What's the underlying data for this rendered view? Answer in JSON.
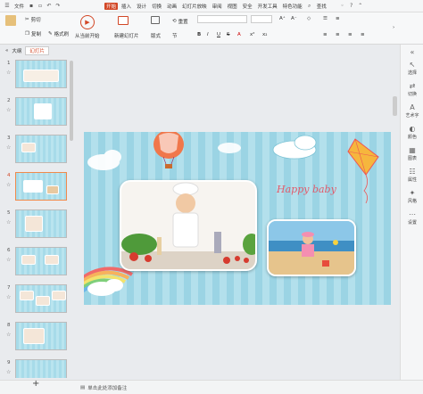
{
  "menubar": {
    "file_label": "文件",
    "tabs": [
      "开始",
      "插入",
      "设计",
      "切换",
      "动画",
      "幻灯片放映",
      "审阅",
      "视图",
      "安全",
      "开发工具",
      "特色功能"
    ],
    "active_tab": "开始",
    "search_label": "查找"
  },
  "ribbon": {
    "cut": "剪切",
    "copy": "复制",
    "format_painter": "格式刷",
    "from_current": "从当前开始",
    "new_slide": "新建幻灯片",
    "layout": "版式",
    "section": "节",
    "reset": "重置"
  },
  "panel": {
    "outline_tab": "大纲",
    "slides_tab": "幻灯片",
    "add_button": "+"
  },
  "slides": [
    {
      "num": "1"
    },
    {
      "num": "2"
    },
    {
      "num": "3"
    },
    {
      "num": "4"
    },
    {
      "num": "5"
    },
    {
      "num": "6"
    },
    {
      "num": "7"
    },
    {
      "num": "8"
    },
    {
      "num": "9"
    }
  ],
  "selected_slide": 4,
  "slide": {
    "title": "Happy baby"
  },
  "rightbar": {
    "items": [
      "选择",
      "切换",
      "艺术字",
      "颜色",
      "图表",
      "属性",
      "风格",
      "设置"
    ]
  },
  "status": {
    "notes_placeholder": "单击此处添加备注"
  },
  "colors": {
    "accent": "#d24726",
    "slide_stripe_a": "#9bd4e4",
    "slide_stripe_b": "#b3e0ec",
    "title_color": "#e25a6a"
  }
}
